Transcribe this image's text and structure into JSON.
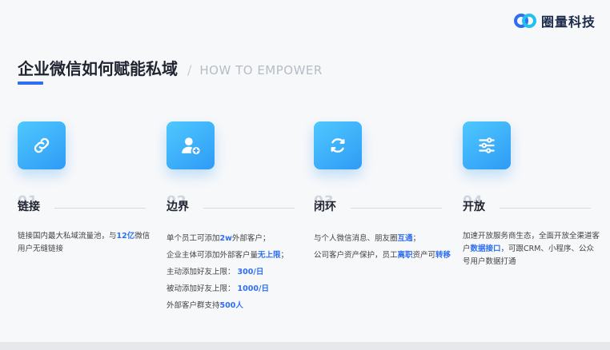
{
  "brand": {
    "name": "圈量科技",
    "logo_colors": [
      "#2f6fef",
      "#22c0f0"
    ]
  },
  "title": {
    "cn": "企业微信如何赋能私域",
    "separator": "/",
    "en": "HOW TO EMPOWER"
  },
  "accent_color": "#2f6fef",
  "columns": [
    {
      "num": "01",
      "heading": "链接",
      "icon": "link-icon",
      "lines": [
        {
          "parts": [
            {
              "text": "链接国内最大私域流量池，与"
            },
            {
              "text": "12亿",
              "hl": true
            },
            {
              "text": "微信用户无缝链接"
            }
          ]
        }
      ]
    },
    {
      "num": "02",
      "heading": "边界",
      "icon": "add-user-icon",
      "lines": [
        {
          "parts": [
            {
              "text": "单个员工可添加"
            },
            {
              "text": "2w",
              "hl": true
            },
            {
              "text": "外部客户；"
            }
          ]
        },
        {
          "parts": [
            {
              "text": "企业主体可添加外部客户量"
            },
            {
              "text": "无上限",
              "hl": true
            },
            {
              "text": "；"
            }
          ]
        },
        {
          "parts": [
            {
              "text": "主动添加好友上限： "
            },
            {
              "text": "300/日",
              "hl": true
            }
          ]
        },
        {
          "parts": [
            {
              "text": "被动添加好友上限： "
            },
            {
              "text": "1000/日",
              "hl": true
            }
          ]
        },
        {
          "parts": [
            {
              "text": "外部客户群支持"
            },
            {
              "text": "500人",
              "hl": true
            }
          ]
        }
      ]
    },
    {
      "num": "03",
      "heading": "闭环",
      "icon": "refresh-cycle-icon",
      "lines": [
        {
          "parts": [
            {
              "text": "与个人微信消息、朋友圈"
            },
            {
              "text": "互通",
              "hl": true
            },
            {
              "text": "；"
            }
          ]
        },
        {
          "parts": [
            {
              "text": "公司客户资产保护，员工"
            },
            {
              "text": "离职",
              "hl": true
            },
            {
              "text": "资产可"
            },
            {
              "text": "转移",
              "hl": true
            }
          ]
        }
      ]
    },
    {
      "num": "04",
      "heading": "开放",
      "icon": "sliders-icon",
      "lines": [
        {
          "parts": [
            {
              "text": "加速开放服务商生态，全面开放全渠道客户"
            },
            {
              "text": "数据接口",
              "hl": true
            },
            {
              "text": "，可跟CRM、小程序、公众号用户数据打通"
            }
          ]
        }
      ]
    }
  ]
}
